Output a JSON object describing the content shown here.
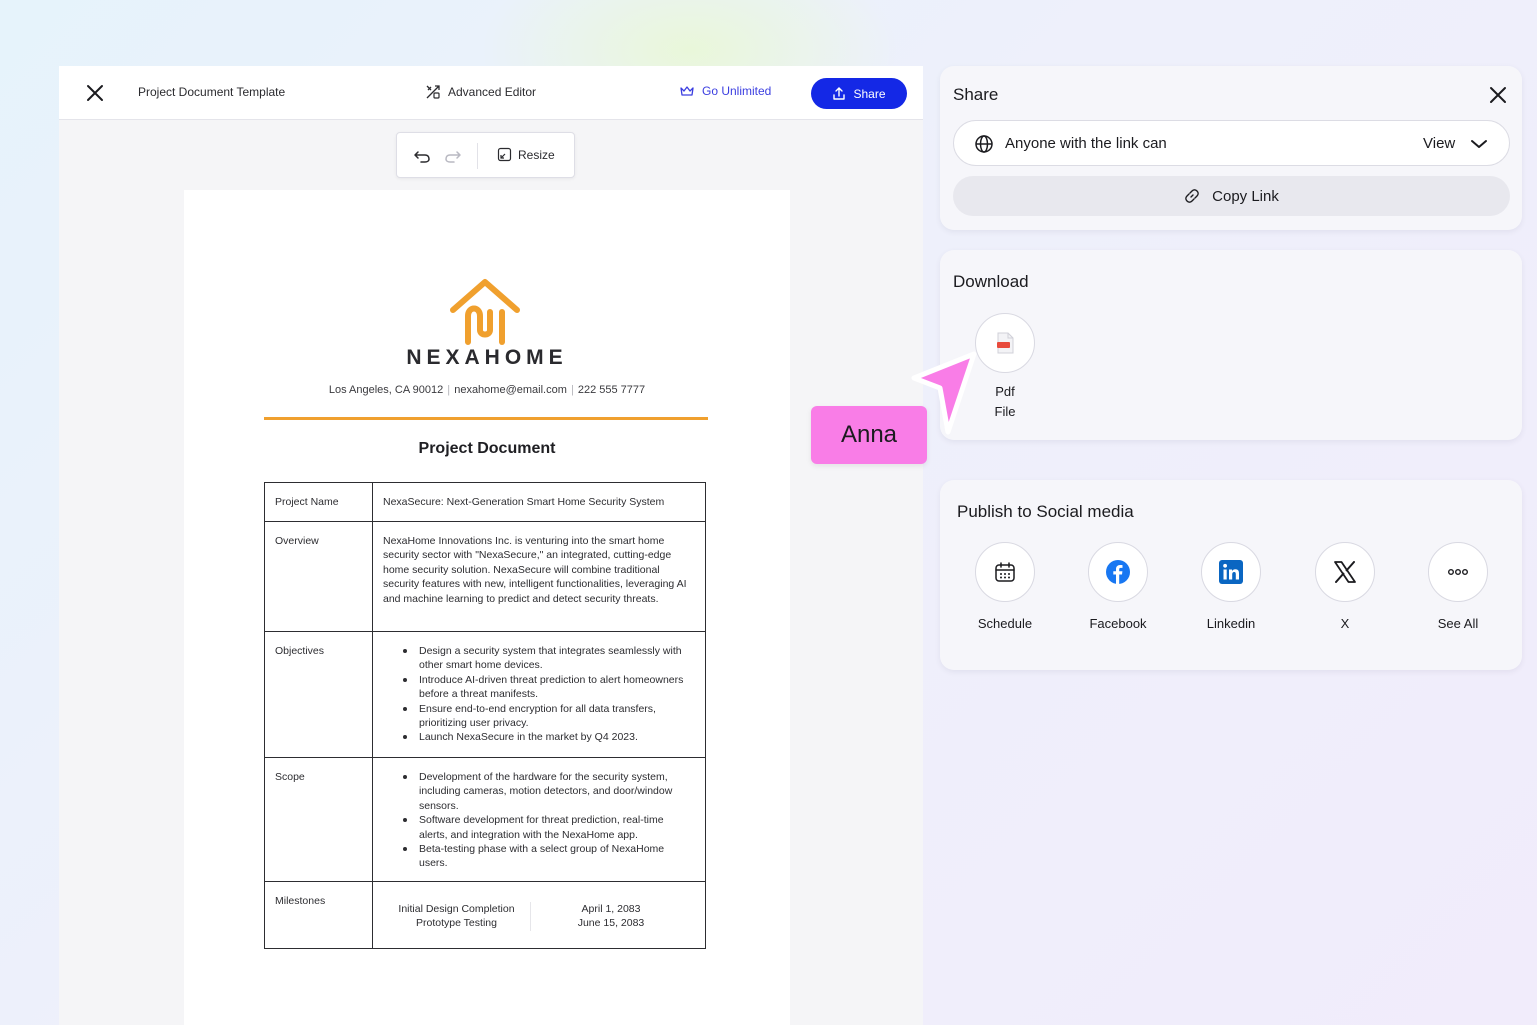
{
  "header": {
    "doc_title": "Project Document Template",
    "advanced_editor": "Advanced Editor",
    "go_unlimited": "Go Unlimited",
    "share": "Share"
  },
  "toolbar": {
    "resize": "Resize"
  },
  "document": {
    "brand": "NEXAHOME",
    "contact": {
      "address": "Los Angeles, CA 90012",
      "email": "nexahome@email.com",
      "phone": "222 555 7777"
    },
    "heading": "Project Document",
    "rows": {
      "project_name": {
        "label": "Project Name",
        "value": "NexaSecure: Next-Generation Smart Home Security System"
      },
      "overview": {
        "label": "Overview",
        "value": "NexaHome Innovations Inc. is venturing into the smart home security sector with \"NexaSecure,\" an integrated, cutting-edge home security solution. NexaSecure will combine traditional security features with new, intelligent functionalities, leveraging AI and machine learning to predict and detect security threats."
      },
      "objectives": {
        "label": "Objectives",
        "items": [
          "Design a security system that integrates seamlessly with other smart home devices.",
          "Introduce AI-driven threat prediction to alert homeowners before a threat manifests.",
          "Ensure end-to-end encryption for all data transfers, prioritizing user privacy.",
          "Launch NexaSecure in the market by Q4 2023."
        ]
      },
      "scope": {
        "label": "Scope",
        "items": [
          "Development of the hardware for the security system, including cameras, motion detectors, and door/window sensors.",
          "Software development for threat prediction, real-time alerts, and integration with the NexaHome app.",
          "Beta-testing phase with a select group of NexaHome users."
        ]
      },
      "milestones": {
        "label": "Milestones",
        "items": [
          {
            "name": "Initial Design Completion",
            "date": "April 1, 2083"
          },
          {
            "name": "Prototype Testing",
            "date": "June 15, 2083"
          }
        ]
      }
    }
  },
  "share_panel": {
    "title": "Share",
    "link_access": "Anyone with the link can",
    "permission": "View",
    "copy_link": "Copy Link"
  },
  "download_panel": {
    "title": "Download",
    "pdf_line1": "Pdf",
    "pdf_line2": "File"
  },
  "social_panel": {
    "title": "Publish to Social media",
    "items": [
      "Schedule",
      "Facebook",
      "Linkedin",
      "X",
      "See All"
    ]
  },
  "cursor": {
    "user_name": "Anna",
    "color": "#f97de7"
  },
  "colors": {
    "primary": "#1428e6",
    "brand_orange": "#f0a02e",
    "facebook": "#1877f2",
    "linkedin": "#0a66c2"
  }
}
